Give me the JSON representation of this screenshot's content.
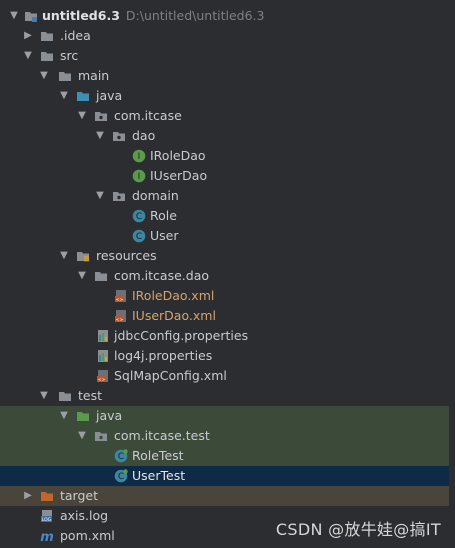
{
  "tree": {
    "project_name": "untitled6.3",
    "project_path": "D:\\untitled\\untitled6.3",
    "idea": ".idea",
    "src": "src",
    "main": "main",
    "java": "java",
    "pkg_main": "com.itcase",
    "dao": "dao",
    "iroledao": "IRoleDao",
    "iuserdao": "IUserDao",
    "domain": "domain",
    "role": "Role",
    "user": "User",
    "resources": "resources",
    "pkg_res": "com.itcase.dao",
    "iroledao_xml": "IRoleDao.xml",
    "iuserdao_xml": "IUserDao.xml",
    "jdbc_props": "jdbcConfig.properties",
    "log4j_props": "log4j.properties",
    "sqlmap_xml": "SqlMapConfig.xml",
    "test": "test",
    "test_java": "java",
    "pkg_test": "com.itcase.test",
    "roletest": "RoleTest",
    "usertest": "UserTest",
    "target": "target",
    "axis_log": "axis.log",
    "pom": "pom.xml"
  },
  "watermark": "CSDN @放牛娃@搞IT",
  "colors": {
    "background": "#2b2d30",
    "selected_row": "#0e2a47",
    "test_row": "#3c4a3a",
    "excluded_row": "#4a453b",
    "interface_icon": "#5a9a4a",
    "class_icon": "#3e86a0"
  }
}
